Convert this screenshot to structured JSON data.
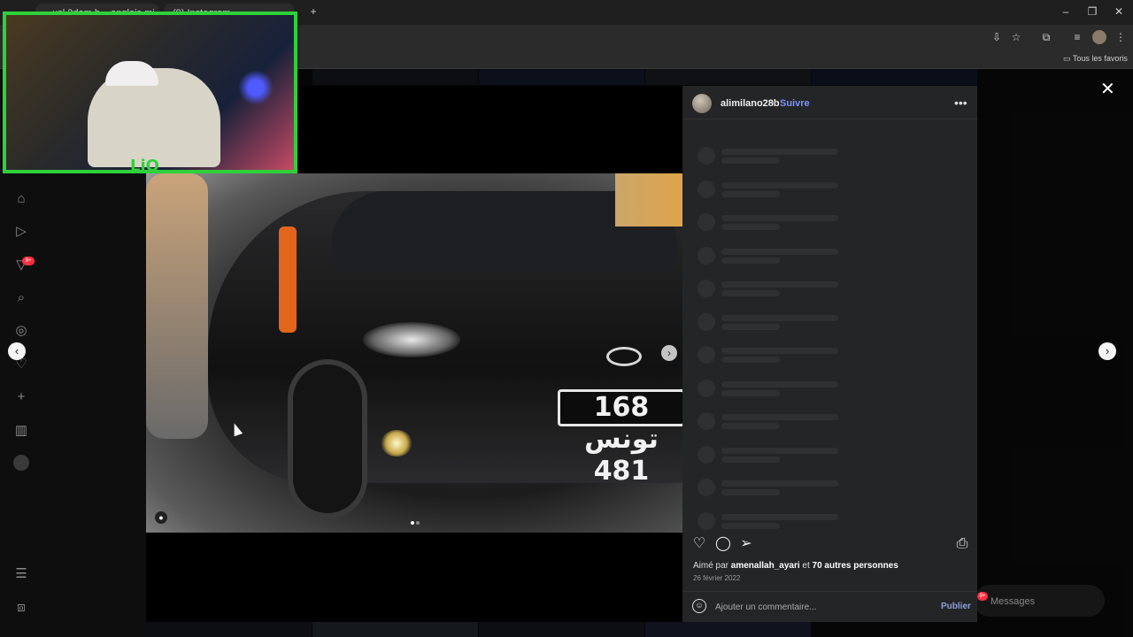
{
  "browser": {
    "tabs": [
      {
        "label": "...usl 2dam b... anglais mi..."
      },
      {
        "label": "(9) Instagram"
      }
    ],
    "new_tab_icon": "plus-icon",
    "window_controls": [
      "minimize-icon",
      "restore-icon",
      "close-icon"
    ],
    "bookmarks_label": "Tous les favoris"
  },
  "sidebar": {
    "icons": [
      "home-icon",
      "reels-icon",
      "notifications-icon",
      "search-icon",
      "explore-icon",
      "activity-icon",
      "create-icon",
      "dashboard-icon",
      "profile-icon",
      "menu-icon",
      "apps-icon"
    ],
    "notification_badge": "9+"
  },
  "webcam": {
    "overlay_text": "LiO"
  },
  "post": {
    "username": "alimilano28b",
    "separator": "•",
    "follow_label": "Suivre",
    "plate_text": "168 تونس 481",
    "carousel_dots": 2,
    "liked_prefix": "Aimé par",
    "liked_user": "amenallah_ayari",
    "liked_middle": "et",
    "liked_others": "70 autres personnes",
    "date": "26 février 2022",
    "comment_placeholder": "Ajouter un commentaire...",
    "publish_label": "Publier"
  },
  "actions": [
    "heart-icon",
    "comment-icon",
    "share-icon",
    "bookmark-icon"
  ],
  "messages": {
    "label": "Messages",
    "badge": "9+"
  },
  "colors": {
    "accent": "#7b93ff",
    "webcam_border": "#2fd13a",
    "badge": "#ff3040"
  }
}
